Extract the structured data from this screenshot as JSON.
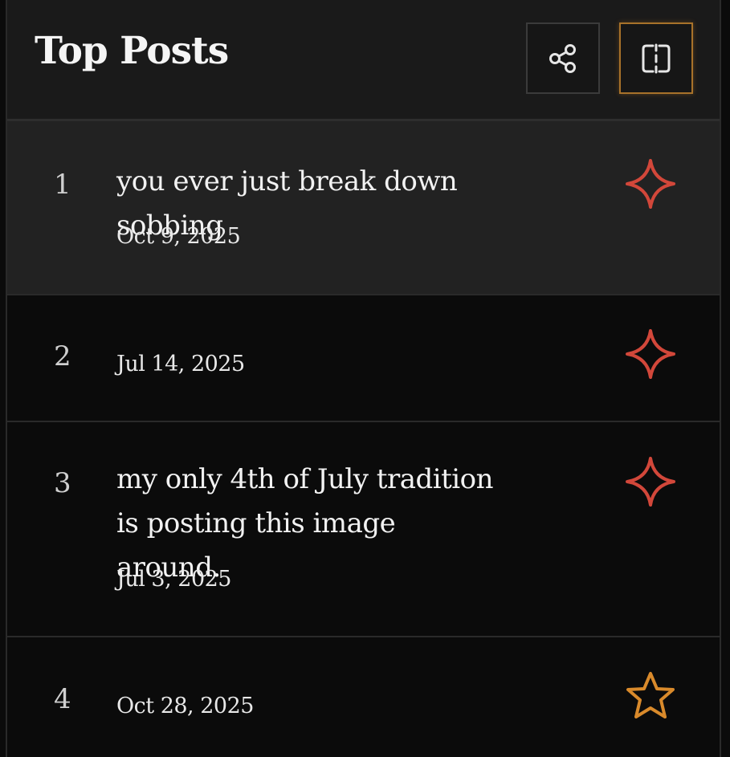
{
  "header": {
    "title": "Top Posts"
  },
  "posts": [
    {
      "rank": "1",
      "title": "you ever just break down sobbing",
      "date": "Oct 9, 2025",
      "icon": "sparkle-icon",
      "icon_color": "#d2473a"
    },
    {
      "rank": "2",
      "title": "",
      "date": "Jul 14, 2025",
      "icon": "sparkle-icon",
      "icon_color": "#d2473a"
    },
    {
      "rank": "3",
      "title": "my only 4th of July tradition is posting this image around.",
      "date": "Jul 3, 2025",
      "icon": "sparkle-icon",
      "icon_color": "#d2473a"
    },
    {
      "rank": "4",
      "title": "",
      "date": "Oct 28, 2025",
      "icon": "star-icon",
      "icon_color": "#d98a2b"
    }
  ],
  "colors": {
    "accent_border": "#a8722a",
    "sparkle": "#d2473a",
    "star": "#d98a2b"
  }
}
